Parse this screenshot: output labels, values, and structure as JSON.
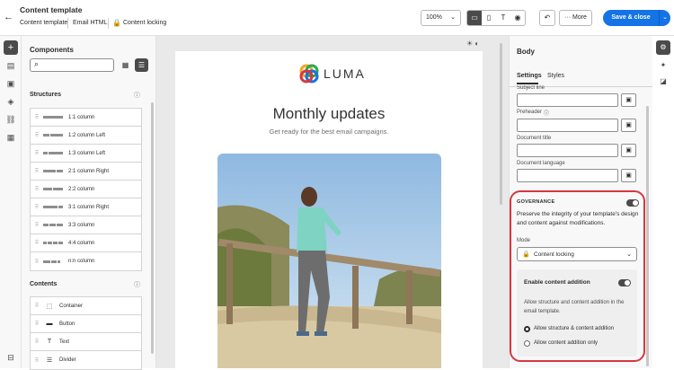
{
  "header": {
    "title": "Content template",
    "tabs": [
      "Content template",
      "Email HTML",
      "Content locking"
    ],
    "zoom": "100%",
    "more_label": "More",
    "save_label": "Save & close"
  },
  "components": {
    "title": "Components",
    "search_placeholder": "",
    "structures_title": "Structures",
    "structures": [
      "1:1 column",
      "1:2 column Left",
      "1:3 column Left",
      "2:1 column Right",
      "2:2 column",
      "3:1 column Right",
      "3:3 column",
      "4:4 column",
      "n:n column"
    ],
    "contents_title": "Contents",
    "contents": [
      "Container",
      "Button",
      "Text",
      "Divider"
    ]
  },
  "email": {
    "brand": "LUMA",
    "headline": "Monthly updates",
    "subheadline": "Get ready for the best email campaigns."
  },
  "props": {
    "title": "Body",
    "tabs": [
      "Settings",
      "Styles"
    ],
    "fields": [
      "Subject line",
      "Preheader",
      "Document title",
      "Document language"
    ],
    "governance": {
      "title": "GOVERNANCE",
      "description": "Preserve the integrity of your template's design and content against modifications.",
      "mode_label": "Mode",
      "mode_value": "Content locking",
      "enable_label": "Enable content addition",
      "enable_desc": "Allow structure and content addition in the email template.",
      "options": [
        "Allow structure & content addition",
        "Allow content addition only"
      ]
    }
  },
  "colors": {
    "accent": "#1473e6",
    "highlight": "#d7373f"
  }
}
